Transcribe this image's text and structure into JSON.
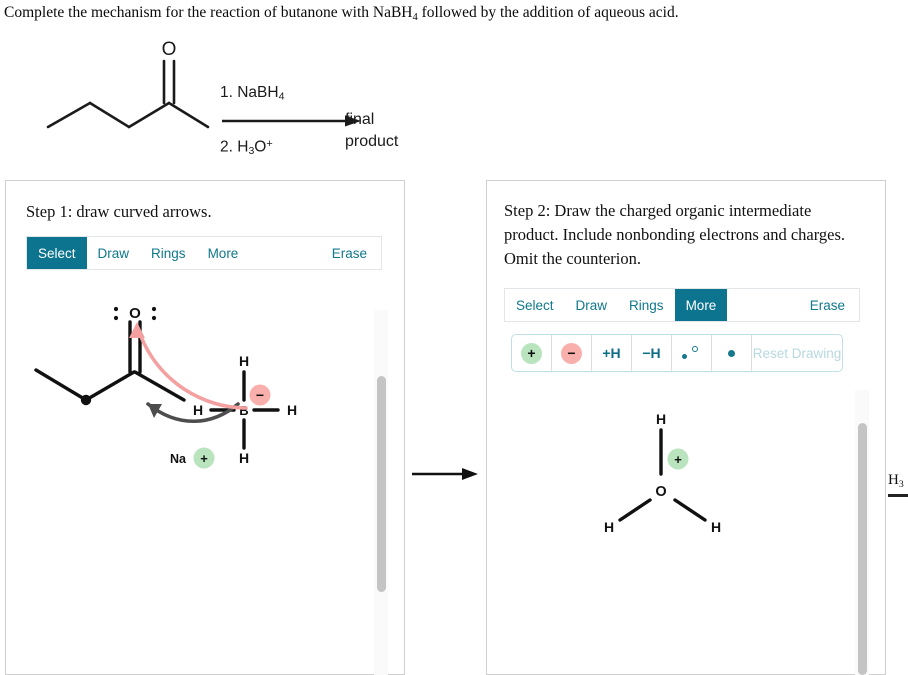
{
  "prompt": {
    "text_before": "Complete the mechanism for the reaction of butanone with NaBH",
    "sub": "4",
    "text_after": " followed by the addition of aqueous acid."
  },
  "scheme": {
    "reagent_line1_prefix": "1. NaBH",
    "reagent_line1_sub": "4",
    "reagent_line2_prefix": "2. H",
    "reagent_line2_sub": "3",
    "reagent_line2_mid": "O",
    "reagent_line2_sup": "+",
    "result_line1": "final",
    "result_line2": "product",
    "oxygen_label": "O"
  },
  "colors": {
    "accent_teal": "#0d7490",
    "link_teal": "#10788c",
    "charge_plus_bg": "#b9e4bd",
    "charge_minus_bg": "#f9b0ac",
    "arrow_pink": "#f4a0a0",
    "arrow_gray": "#4d4d4d",
    "panel_border": "#cfcfcf",
    "reset_disabled": "#b7d8e0"
  },
  "panel_left": {
    "step_title": "Step 1: draw curved arrows.",
    "toolbar": {
      "tabs": [
        {
          "label": "Select",
          "active": true
        },
        {
          "label": "Draw",
          "active": false
        },
        {
          "label": "Rings",
          "active": false
        },
        {
          "label": "More",
          "active": false
        }
      ],
      "erase_label": "Erase"
    },
    "canvas": {
      "molecule": "butanone-with-borohydride-and-curved-arrows",
      "atom_labels": {
        "oxygen": "O",
        "boron": "B",
        "hydrogen": "H",
        "sodium": "Na"
      },
      "hydrogen_labels": [
        "H",
        "H",
        "H",
        "H"
      ],
      "sodium_label": "Na",
      "sodium_charge": "+",
      "borohydride_charge": "−"
    }
  },
  "panel_right": {
    "step_title": "Step 2: Draw the charged organic intermediate product. Include nonbonding electrons and charges. Omit the counterion.",
    "toolbar": {
      "tabs": [
        {
          "label": "Select",
          "active": false
        },
        {
          "label": "Draw",
          "active": false
        },
        {
          "label": "Rings",
          "active": false
        },
        {
          "label": "More",
          "active": true
        }
      ],
      "erase_label": "Erase"
    },
    "subtoolbar": {
      "buttons": [
        {
          "name": "add-positive-charge",
          "label": "+"
        },
        {
          "name": "add-negative-charge",
          "label": "−"
        },
        {
          "name": "add-hydrogen",
          "label": "+H"
        },
        {
          "name": "remove-hydrogen",
          "label": "−H"
        },
        {
          "name": "lone-pair",
          "label": ""
        },
        {
          "name": "radical-dot",
          "label": ""
        }
      ],
      "reset_label": "Reset Drawing"
    },
    "canvas": {
      "molecule": "hydronium-ion",
      "center_atom": "O",
      "hydrogen_labels": [
        "H",
        "H",
        "H"
      ],
      "charge": "+"
    }
  },
  "clipped_fragment": {
    "label": "H",
    "sub": "3"
  }
}
